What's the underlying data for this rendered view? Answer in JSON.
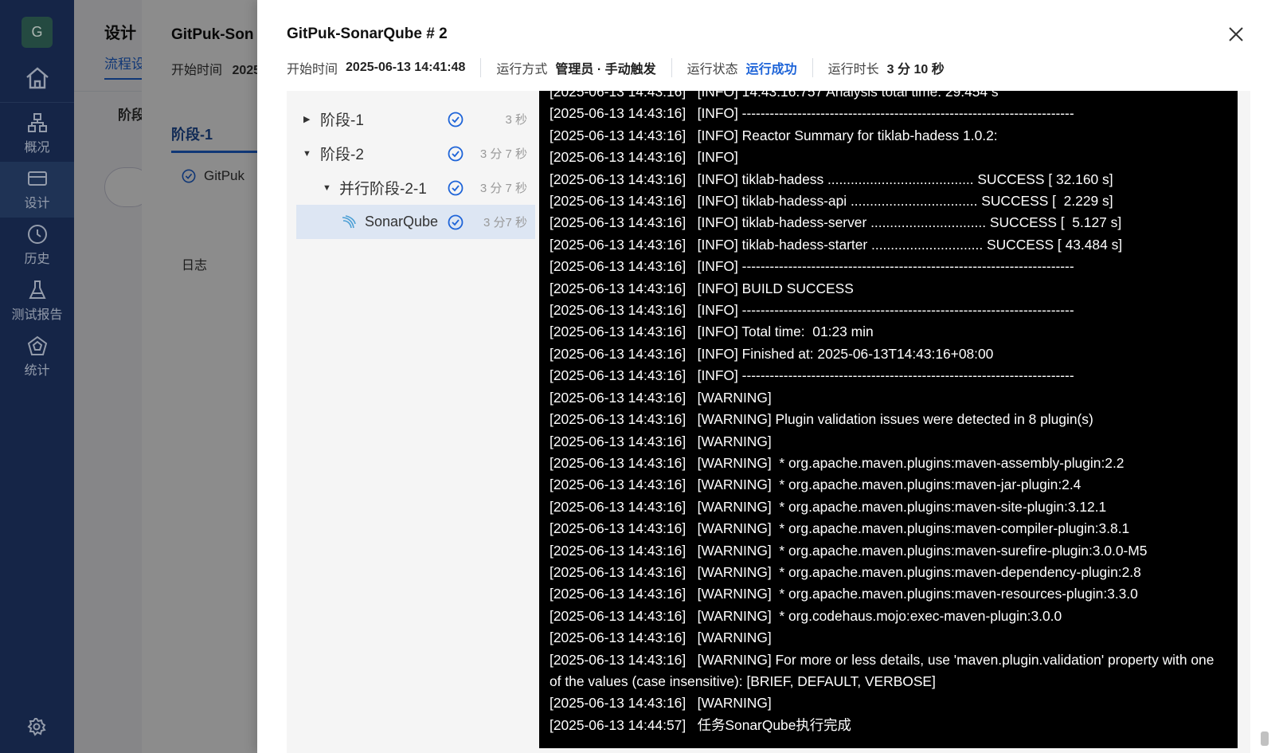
{
  "nav": {
    "avatar_letter": "G",
    "items": [
      {
        "label": "概况",
        "icon": "overview-icon"
      },
      {
        "label": "设计",
        "icon": "design-icon"
      },
      {
        "label": "历史",
        "icon": "history-icon"
      },
      {
        "label": "测试报告",
        "icon": "test-report-icon"
      },
      {
        "label": "统计",
        "icon": "statistics-icon"
      }
    ]
  },
  "background": {
    "title": "设计",
    "tab": "流程设",
    "stage": "阶段",
    "mid_title": "GitPuk-Son",
    "mid_start_label": "开始时间",
    "mid_start_value": "2025",
    "mid_tab": "阶段-1",
    "mid_job": "GitPuk",
    "mid_log": "日志"
  },
  "drawer": {
    "title": "GitPuk-SonarQube # 2",
    "meta": {
      "start_label": "开始时间",
      "start_value": "2025-06-13 14:41:48",
      "mode_label": "运行方式",
      "mode_value": "管理员 · 手动触发",
      "status_label": "运行状态",
      "status_value": "运行成功",
      "duration_label": "运行时长",
      "duration_value": "3 分 10 秒"
    },
    "tree": [
      {
        "label": "阶段-1",
        "duration": "3 秒"
      },
      {
        "label": "阶段-2",
        "duration": "3 分 7 秒"
      },
      {
        "label": "并行阶段-2-1",
        "duration": "3 分 7 秒"
      },
      {
        "label": "SonarQube",
        "duration": "3 分7 秒"
      }
    ],
    "log_lines": [
      "[2025-06-13 14:43:16]   [INFO] 14:43:16.757 Analysis total time: 29.454 s",
      "[2025-06-13 14:43:16]   [INFO] ------------------------------------------------------------------------",
      "[2025-06-13 14:43:16]   [INFO] Reactor Summary for tiklab-hadess 1.0.2:",
      "[2025-06-13 14:43:16]   [INFO]",
      "[2025-06-13 14:43:16]   [INFO] tiklab-hadess ...................................... SUCCESS [ 32.160 s]",
      "[2025-06-13 14:43:16]   [INFO] tiklab-hadess-api ................................. SUCCESS [  2.229 s]",
      "[2025-06-13 14:43:16]   [INFO] tiklab-hadess-server .............................. SUCCESS [  5.127 s]",
      "[2025-06-13 14:43:16]   [INFO] tiklab-hadess-starter ............................. SUCCESS [ 43.484 s]",
      "[2025-06-13 14:43:16]   [INFO] ------------------------------------------------------------------------",
      "[2025-06-13 14:43:16]   [INFO] BUILD SUCCESS",
      "[2025-06-13 14:43:16]   [INFO] ------------------------------------------------------------------------",
      "[2025-06-13 14:43:16]   [INFO] Total time:  01:23 min",
      "[2025-06-13 14:43:16]   [INFO] Finished at: 2025-06-13T14:43:16+08:00",
      "[2025-06-13 14:43:16]   [INFO] ------------------------------------------------------------------------",
      "[2025-06-13 14:43:16]   [WARNING]",
      "[2025-06-13 14:43:16]   [WARNING] Plugin validation issues were detected in 8 plugin(s)",
      "[2025-06-13 14:43:16]   [WARNING]",
      "[2025-06-13 14:43:16]   [WARNING]  * org.apache.maven.plugins:maven-assembly-plugin:2.2",
      "[2025-06-13 14:43:16]   [WARNING]  * org.apache.maven.plugins:maven-jar-plugin:2.4",
      "[2025-06-13 14:43:16]   [WARNING]  * org.apache.maven.plugins:maven-site-plugin:3.12.1",
      "[2025-06-13 14:43:16]   [WARNING]  * org.apache.maven.plugins:maven-compiler-plugin:3.8.1",
      "[2025-06-13 14:43:16]   [WARNING]  * org.apache.maven.plugins:maven-surefire-plugin:3.0.0-M5",
      "[2025-06-13 14:43:16]   [WARNING]  * org.apache.maven.plugins:maven-dependency-plugin:2.8",
      "[2025-06-13 14:43:16]   [WARNING]  * org.apache.maven.plugins:maven-resources-plugin:3.3.0",
      "[2025-06-13 14:43:16]   [WARNING]  * org.codehaus.mojo:exec-maven-plugin:3.0.0",
      "[2025-06-13 14:43:16]   [WARNING]",
      "[2025-06-13 14:43:16]   [WARNING] For more or less details, use 'maven.plugin.validation' property with one of the values (case insensitive): [BRIEF, DEFAULT, VERBOSE]",
      "[2025-06-13 14:43:16]   [WARNING]",
      "[2025-06-13 14:44:57]   任务SonarQube执行完成"
    ]
  },
  "colors": {
    "nav_bg": "#1b2f59",
    "accent": "#1e64d8",
    "log_bg": "#000000",
    "selected_row": "#dde6f3"
  }
}
